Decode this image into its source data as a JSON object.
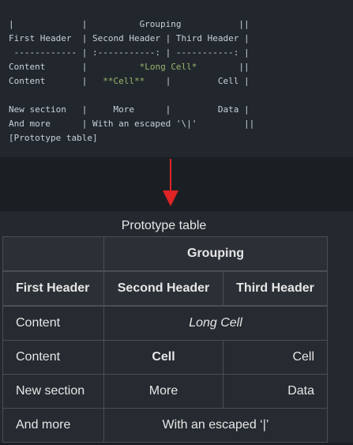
{
  "source": {
    "lines": [
      "|             |          Grouping           ||",
      "First Header  | Second Header | Third Header |",
      " ------------ | :-----------: | -----------: |",
      "Content       |          *Long Cell*        ||",
      "Content       |   **Cell**    |         Cell |",
      "",
      "New section   |     More      |         Data |",
      "And more      | With an escaped '\\|'         ||",
      "[Prototype table]"
    ]
  },
  "table": {
    "caption": "Prototype table",
    "group_header": "Grouping",
    "headers": [
      "First Header",
      "Second Header",
      "Third Header"
    ],
    "rows": {
      "r1": {
        "c1": "Content",
        "c2": "Long Cell"
      },
      "r2": {
        "c1": "Content",
        "c2": "Cell",
        "c3": "Cell"
      },
      "r3": {
        "c1": "New section",
        "c2": "More",
        "c3": "Data"
      },
      "r4": {
        "c1": "And more",
        "c2": "With an escaped ‘|’"
      }
    }
  },
  "colors": {
    "arrow": "#e02424",
    "emphasis_highlight": "#9ab46a"
  }
}
